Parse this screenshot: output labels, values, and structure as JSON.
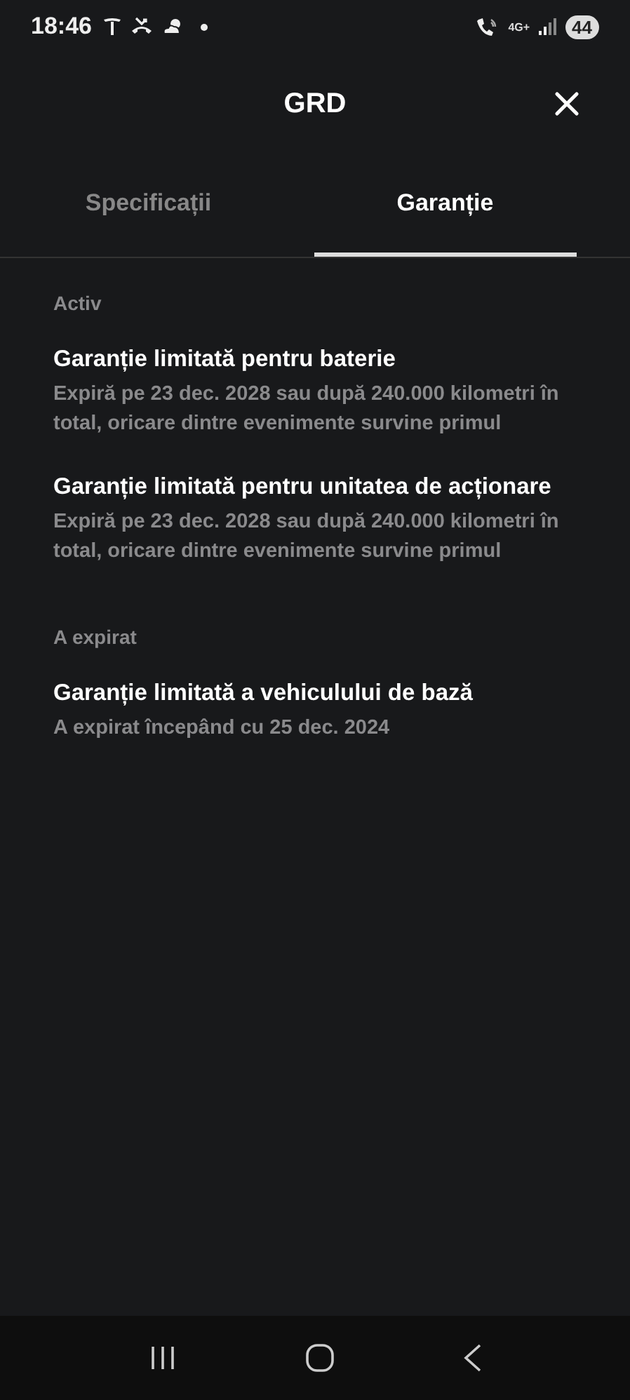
{
  "status_bar": {
    "time": "18:46",
    "network": "4G+",
    "battery": "44"
  },
  "header": {
    "title": "GRD"
  },
  "tabs": [
    {
      "label": "Specificații",
      "selected": false
    },
    {
      "label": "Garanție",
      "selected": true
    }
  ],
  "sections": [
    {
      "label": "Activ",
      "items": [
        {
          "title": "Garanție limitată pentru baterie",
          "description": "Expiră pe 23 dec. 2028 sau după 240.000 kilometri în total, oricare dintre evenimente survine primul"
        },
        {
          "title": "Garanție limitată pentru unitatea de acționare",
          "description": "Expiră pe 23 dec. 2028 sau după 240.000 kilometri în total, oricare dintre evenimente survine primul"
        }
      ]
    },
    {
      "label": "A expirat",
      "items": [
        {
          "title": "Garanție limitată a vehiculului de bază",
          "description": "A expirat începând cu 25 dec. 2024"
        }
      ]
    }
  ]
}
